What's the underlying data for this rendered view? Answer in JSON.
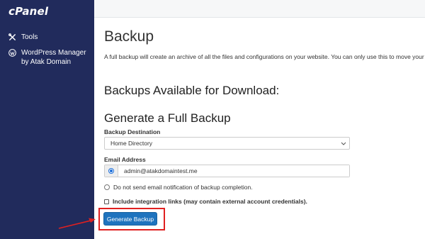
{
  "brand": {
    "logo": "cPanel"
  },
  "sidebar": {
    "items": [
      {
        "label": "Tools",
        "icon": "tools-icon"
      },
      {
        "label": "WordPress Manager by Atak Domain",
        "icon": "wordpress-icon"
      }
    ]
  },
  "page": {
    "title": "Backup",
    "description": "A full backup will create an archive of all the files and configurations on your website. You can only use this to move your account restore full backups through your cPanel interface."
  },
  "sections": {
    "available_heading": "Backups Available for Download:",
    "generate_heading": "Generate a Full Backup"
  },
  "form": {
    "destination_label": "Backup Destination",
    "destination_value": "Home Directory",
    "email_label": "Email Address",
    "email_value": "admin@atakdomaintest.me",
    "no_email_option": "Do not send email notification of backup completion.",
    "integration_option": "Include integration links (may contain external account credentials).",
    "generate_button": "Generate Backup"
  },
  "colors": {
    "sidebar_bg": "#212b5c",
    "button_bg": "#1e73be",
    "highlight": "#e02020"
  }
}
